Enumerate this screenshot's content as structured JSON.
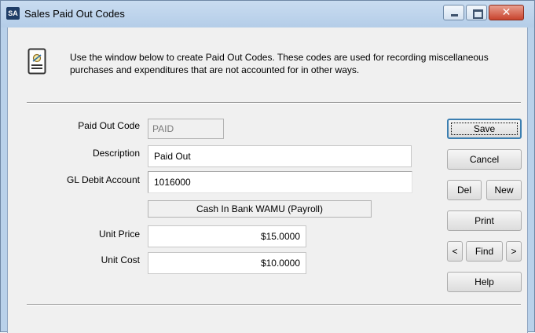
{
  "window": {
    "app_icon_text": "SA",
    "title": "Sales Paid Out Codes",
    "min_icon": "minimize-icon",
    "max_icon": "maximize-icon",
    "close_icon": "close-icon",
    "close_glyph": "✕"
  },
  "info": {
    "icon": "document-icon",
    "text": "Use the window below to create Paid Out Codes. These codes are used for recording miscellaneous purchases and expenditures that are not accounted for in other ways."
  },
  "form": {
    "paid_out_code_label": "Paid Out Code",
    "paid_out_code_value": "PAID",
    "description_label": "Description",
    "description_value": "Paid Out",
    "gl_debit_label": "GL Debit Account",
    "gl_debit_value": "1016000",
    "gl_account_name": "Cash In Bank WAMU (Payroll)",
    "unit_price_label": "Unit Price",
    "unit_price_value": "$15.0000",
    "unit_cost_label": "Unit Cost",
    "unit_cost_value": "$10.0000"
  },
  "buttons": {
    "save": "Save",
    "cancel": "Cancel",
    "del": "Del",
    "new": "New",
    "print": "Print",
    "prev": "<",
    "find": "Find",
    "next": ">",
    "help": "Help"
  }
}
